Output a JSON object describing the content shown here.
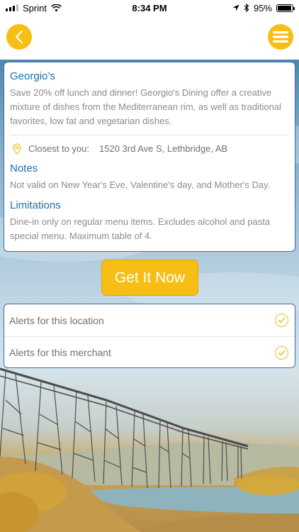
{
  "status_bar": {
    "carrier": "Sprint",
    "time": "8:34 PM",
    "battery": "95%",
    "battery_level": 0.95
  },
  "header": {
    "back_icon": "chevron-left-icon",
    "menu_icon": "hamburger-menu-icon",
    "accent_color": "#f7be16"
  },
  "deal": {
    "title": "Georgio’s",
    "description": "Save 20% off lunch and dinner! Georgio's Dining offer a creative mixture of dishes from the Mediterranean rim, as well as traditional favorites, low fat and vegetarian dishes.",
    "location_label": "Closest to you:",
    "address": "1520 3rd Ave S, Lethbridge, AB",
    "notes_title": "Notes",
    "notes_text": "Not valid on New Year's Eve, Valentine's day, and Mother's Day.",
    "limitations_title": "Limitations",
    "limitations_text": "Dine-in only on regular menu items. Excludes alcohol and pasta special menu. Maximum table of 4."
  },
  "cta": {
    "label": "Get It Now"
  },
  "alerts": [
    {
      "label": "Alerts for this location"
    },
    {
      "label": "Alerts for this merchant"
    }
  ]
}
